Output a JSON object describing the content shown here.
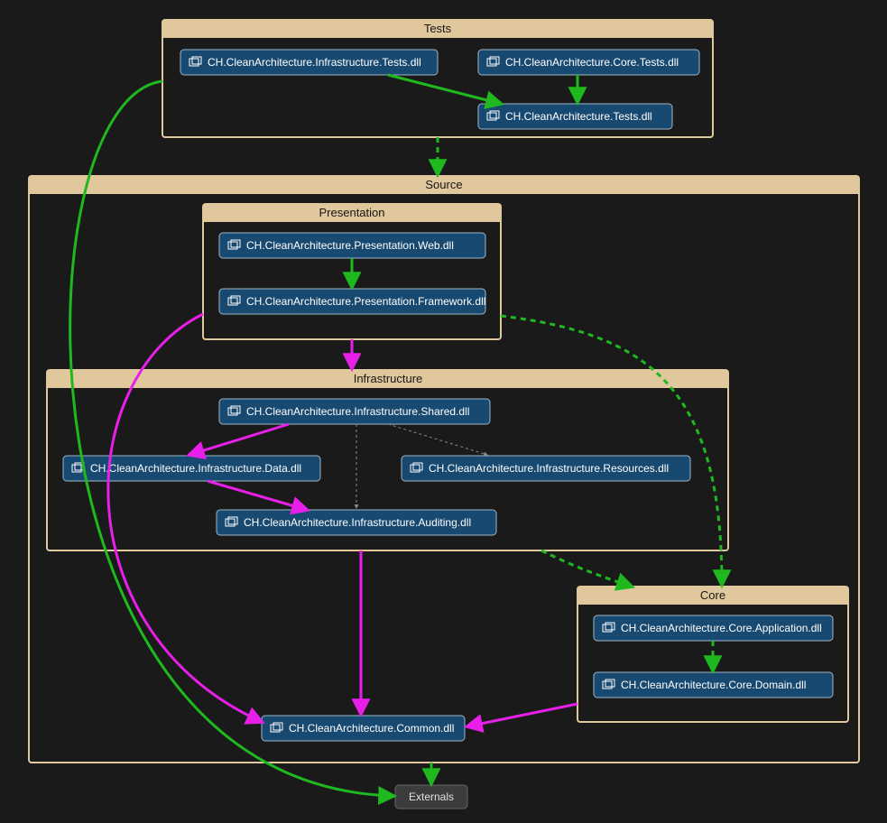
{
  "diagram": {
    "groups": {
      "tests": {
        "title": "Tests"
      },
      "source": {
        "title": "Source"
      },
      "presentation": {
        "title": "Presentation"
      },
      "infrastructure": {
        "title": "Infrastructure"
      },
      "core": {
        "title": "Core"
      }
    },
    "nodes": {
      "infraTests": "CH.CleanArchitecture.Infrastructure.Tests.dll",
      "coreTests": "CH.CleanArchitecture.Core.Tests.dll",
      "tests": "CH.CleanArchitecture.Tests.dll",
      "presWeb": "CH.CleanArchitecture.Presentation.Web.dll",
      "presFw": "CH.CleanArchitecture.Presentation.Framework.dll",
      "infraShared": "CH.CleanArchitecture.Infrastructure.Shared.dll",
      "infraData": "CH.CleanArchitecture.Infrastructure.Data.dll",
      "infraRes": "CH.CleanArchitecture.Infrastructure.Resources.dll",
      "infraAudit": "CH.CleanArchitecture.Infrastructure.Auditing.dll",
      "coreApp": "CH.CleanArchitecture.Core.Application.dll",
      "coreDomain": "CH.CleanArchitecture.Core.Domain.dll",
      "common": "CH.CleanArchitecture.Common.dll",
      "externals": "Externals"
    },
    "edges": [
      {
        "from": "infraTests",
        "to": "tests",
        "style": "green"
      },
      {
        "from": "coreTests",
        "to": "tests",
        "style": "green"
      },
      {
        "from": "tests-group",
        "to": "source-group",
        "style": "green-dashed"
      },
      {
        "from": "presWeb",
        "to": "presFw",
        "style": "green"
      },
      {
        "from": "presentation-group",
        "to": "infrastructure-group",
        "style": "magenta"
      },
      {
        "from": "presentation-group",
        "to": "core-group",
        "style": "green-dashed"
      },
      {
        "from": "presentation-group",
        "to": "common",
        "style": "magenta"
      },
      {
        "from": "infraShared",
        "to": "infraData",
        "style": "magenta"
      },
      {
        "from": "infraShared",
        "to": "infraAudit",
        "style": "gray-dashed"
      },
      {
        "from": "infraShared",
        "to": "infraRes",
        "style": "gray-dashed"
      },
      {
        "from": "infraData",
        "to": "infraAudit",
        "style": "magenta"
      },
      {
        "from": "infrastructure-group",
        "to": "core-group",
        "style": "green-dashed"
      },
      {
        "from": "infrastructure-group",
        "to": "common",
        "style": "magenta"
      },
      {
        "from": "coreApp",
        "to": "coreDomain",
        "style": "green-dashed"
      },
      {
        "from": "core-group",
        "to": "common",
        "style": "magenta"
      },
      {
        "from": "source-group",
        "to": "externals",
        "style": "green"
      },
      {
        "from": "tests-group",
        "to": "externals",
        "style": "green"
      }
    ]
  }
}
